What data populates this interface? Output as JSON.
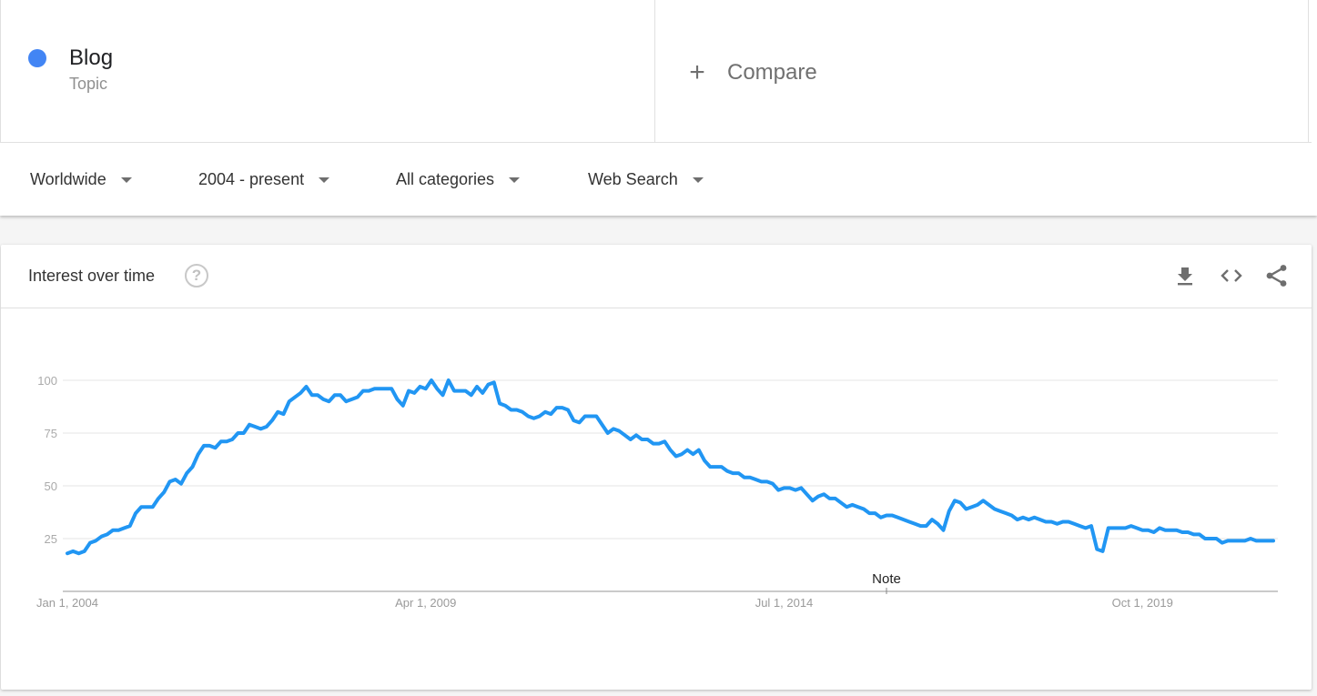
{
  "term": {
    "name": "Blog",
    "type": "Topic",
    "color": "#4285f4"
  },
  "compare": {
    "icon": "plus-icon",
    "plus_glyph": "+",
    "label": "Compare"
  },
  "filters": [
    {
      "label": "Worldwide"
    },
    {
      "label": "2004 - present"
    },
    {
      "label": "All categories"
    },
    {
      "label": "Web Search"
    }
  ],
  "card": {
    "title": "Interest over time",
    "help_glyph": "?",
    "actions": [
      "download-icon",
      "embed-code-icon",
      "share-icon"
    ]
  },
  "chart_data": {
    "type": "line",
    "title": "Interest over time",
    "xlabel": "",
    "ylabel": "",
    "ylim": [
      0,
      100
    ],
    "y_ticks": [
      25,
      50,
      75,
      100
    ],
    "y_tick_labels": [
      "25",
      "50",
      "75",
      "100"
    ],
    "x_start": "2004-01",
    "x_end": "2021-09",
    "x_interval": "monthly",
    "x_tick_labels": [
      {
        "label": "Jan 1, 2004",
        "month_index": 0
      },
      {
        "label": "Apr 1, 2009",
        "month_index": 63
      },
      {
        "label": "Jul 1, 2014",
        "month_index": 126
      },
      {
        "label": "Oct 1, 2019",
        "month_index": 189
      }
    ],
    "annotations": [
      {
        "label": "Note",
        "month_index": 144
      }
    ],
    "grid": true,
    "line_color": "#2196f3",
    "series": [
      {
        "name": "Blog",
        "values": [
          18,
          19,
          18,
          19,
          23,
          24,
          26,
          27,
          29,
          29,
          30,
          31,
          37,
          40,
          40,
          40,
          44,
          47,
          52,
          53,
          51,
          56,
          59,
          65,
          69,
          69,
          68,
          71,
          71,
          72,
          75,
          75,
          79,
          78,
          77,
          78,
          81,
          85,
          84,
          90,
          92,
          94,
          97,
          93,
          93,
          91,
          90,
          93,
          93,
          90,
          91,
          92,
          95,
          95,
          96,
          96,
          96,
          96,
          91,
          88,
          95,
          94,
          97,
          96,
          100,
          96,
          93,
          100,
          95,
          95,
          95,
          93,
          97,
          94,
          98,
          99,
          89,
          88,
          86,
          86,
          85,
          83,
          82,
          83,
          85,
          84,
          87,
          87,
          86,
          81,
          80,
          83,
          83,
          83,
          79,
          75,
          77,
          76,
          74,
          72,
          74,
          72,
          72,
          70,
          70,
          71,
          67,
          64,
          65,
          67,
          65,
          67,
          62,
          59,
          59,
          59,
          57,
          56,
          56,
          54,
          54,
          53,
          52,
          52,
          51,
          48,
          49,
          49,
          48,
          49,
          46,
          43,
          45,
          46,
          44,
          44,
          42,
          40,
          41,
          40,
          39,
          37,
          37,
          35,
          36,
          36,
          35,
          34,
          33,
          32,
          31,
          31,
          34,
          32,
          29,
          38,
          43,
          42,
          39,
          40,
          41,
          43,
          41,
          39,
          38,
          37,
          36,
          34,
          35,
          34,
          35,
          34,
          33,
          33,
          32,
          33,
          33,
          32,
          31,
          30,
          31,
          20,
          19,
          30,
          30,
          30,
          30,
          31,
          30,
          29,
          29,
          28,
          30,
          29,
          29,
          29,
          28,
          28,
          27,
          27,
          25,
          25,
          25,
          23,
          24,
          24,
          24,
          24,
          25,
          24,
          24,
          24,
          24
        ]
      }
    ]
  }
}
